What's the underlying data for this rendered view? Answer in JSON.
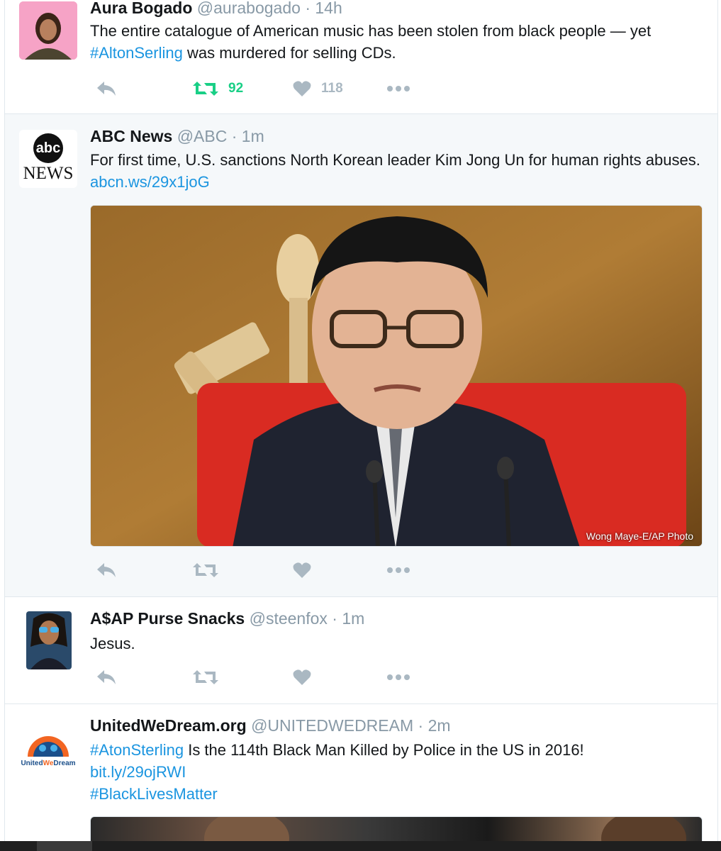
{
  "tweets": [
    {
      "name": "Aura Bogado",
      "handle": "@aurabogado",
      "separator": "·",
      "time": "14h",
      "text_parts": [
        {
          "text": "The entire catalogue of American music has been stolen from black people — yet ",
          "link": false
        },
        {
          "text": "#AltonSerling",
          "link": true
        },
        {
          "text": " was murdered for selling CDs.",
          "link": false
        }
      ],
      "retweet_count": "92",
      "like_count": "118",
      "avatar_icon": "avatar-photo-woman"
    },
    {
      "name": "ABC News",
      "handle": "@ABC",
      "separator": "·",
      "time": "1m",
      "text_parts": [
        {
          "text": "For first time, U.S. sanctions North Korean leader Kim Jong Un for human rights abuses. ",
          "link": false
        },
        {
          "text": "abcn.ws/29x1joG",
          "link": true
        }
      ],
      "avatar_logo_top": "abc",
      "avatar_logo_bottom": "NEWS",
      "media_credit": "Wong Maye-E/AP Photo"
    },
    {
      "name": "A$AP Purse Snacks",
      "handle": "@steenfox",
      "separator": "·",
      "time": "1m",
      "text_parts": [
        {
          "text": "Jesus.",
          "link": false
        }
      ],
      "avatar_icon": "avatar-photo-woman-sunglasses"
    },
    {
      "name": "UnitedWeDream.org",
      "handle": "@UNITEDWEDREAM",
      "separator": "·",
      "time": "2m",
      "text_lines": [
        {
          "parts": [
            {
              "text": "#AtonSterling",
              "link": true
            },
            {
              "text": " Is the 114th Black Man Killed by Police in the US in 2016!",
              "link": false
            }
          ]
        },
        {
          "parts": [
            {
              "text": "bit.ly/29ojRWI",
              "link": true
            }
          ]
        },
        {
          "parts": [
            {
              "text": "#BlackLivesMatter",
              "link": true
            }
          ]
        }
      ],
      "avatar_logo_part1": "United",
      "avatar_logo_part2": "We",
      "avatar_logo_part3": "Dream"
    }
  ],
  "icons": {
    "reply": "reply-icon",
    "retweet": "retweet-icon",
    "like": "heart-icon",
    "more": "more-dots-icon"
  },
  "colors": {
    "link": "#1b95e0",
    "retweet_active": "#19cf86",
    "action_inactive": "#aab8c2",
    "muted": "#8899a6"
  }
}
